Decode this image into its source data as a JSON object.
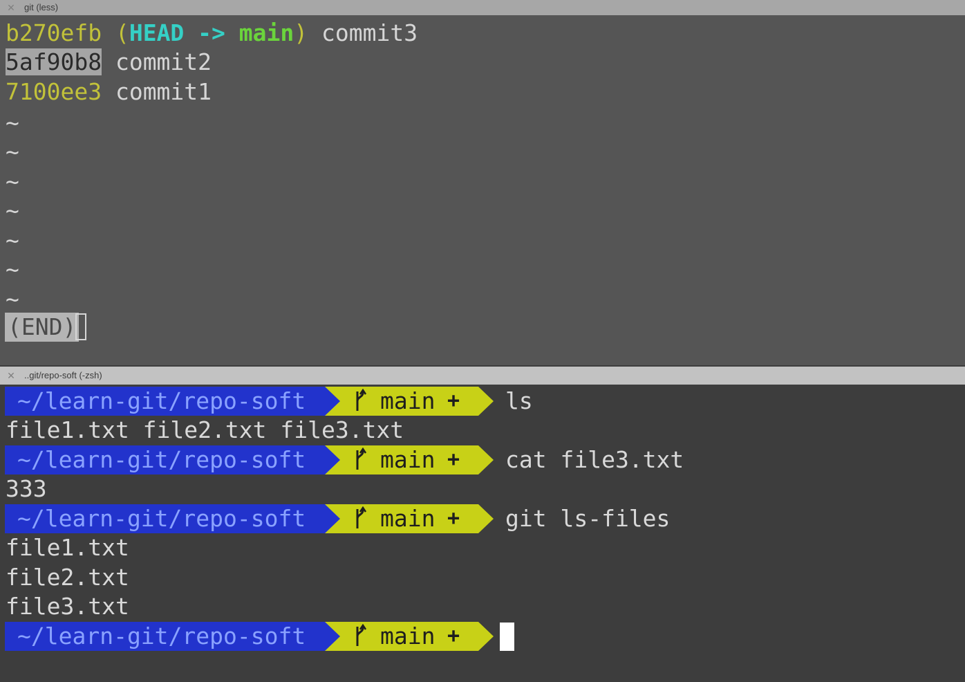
{
  "top_pane": {
    "tab_title": "git (less)",
    "log": [
      {
        "hash": "b270efb",
        "decoration": {
          "open": "(",
          "head": "HEAD",
          "arrow": " -> ",
          "branch": "main",
          "close": ")"
        },
        "message": "commit3"
      },
      {
        "hash": "5af90b8",
        "message": "commit2"
      },
      {
        "hash": "7100ee3",
        "message": "commit1"
      }
    ],
    "tilde": "~",
    "end_label": "(END)"
  },
  "bottom_pane": {
    "tab_title": "..git/repo-soft (-zsh)",
    "prompt": {
      "path": "~/learn-git/repo-soft",
      "branch": "main",
      "status": "+"
    },
    "commands": [
      "ls",
      "cat file3.txt",
      "git ls-files"
    ],
    "outputs": {
      "ls": "file1.txt file2.txt file3.txt",
      "cat": "333",
      "ls_files": [
        "file1.txt",
        "file2.txt",
        "file3.txt"
      ]
    }
  },
  "icons": {
    "tab_close": "close-icon",
    "branch": "git-branch-icon"
  },
  "colors": {
    "prompt_path_bg": "#2233cc",
    "prompt_branch_bg": "#c8d117",
    "hash": "#c2c23a",
    "head": "#35d0c6",
    "branch_ref": "#6bd43c"
  }
}
